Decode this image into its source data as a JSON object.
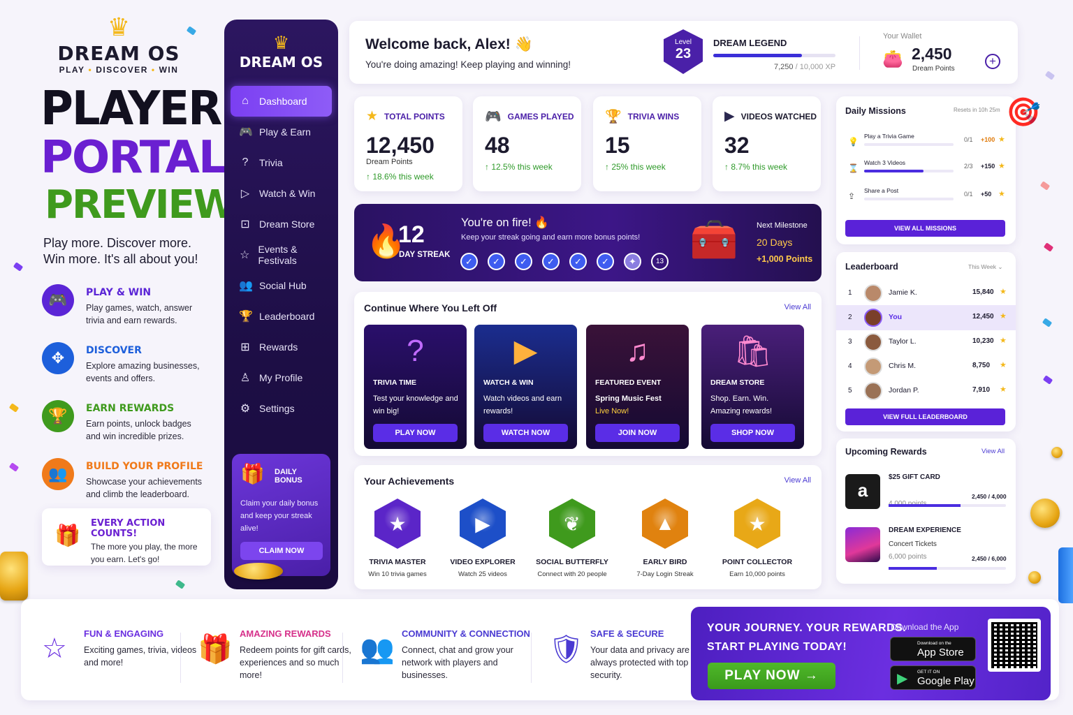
{
  "brand": {
    "name": "DREAM OS",
    "sub": [
      "PLAY",
      "DISCOVER",
      "WIN"
    ],
    "title_line1": "PLAYER",
    "title_line2": "PORTAL",
    "title_line3": "PREVIEW",
    "tagline_1": "Play more. Discover more.",
    "tagline_2": "Win more. It's all about you!"
  },
  "features": [
    {
      "title": "PLAY & WIN",
      "desc": "Play games, watch, answer trivia and earn rewards.",
      "color": "#5b25d6",
      "icon": "gamepad-icon"
    },
    {
      "title": "DISCOVER",
      "desc": "Explore amazing businesses, events and offers.",
      "color": "#1d5fdb",
      "icon": "compass-icon"
    },
    {
      "title": "EARN REWARDS",
      "desc": "Earn points, unlock badges and win incredible prizes.",
      "color": "#3f9a1d",
      "icon": "trophy-icon"
    },
    {
      "title": "BUILD YOUR PROFILE",
      "desc": "Showcase your achievements and climb the leaderboard.",
      "color": "#f07a1a",
      "icon": "people-icon"
    }
  ],
  "every_action": {
    "title": "EVERY ACTION COUNTS!",
    "desc": "The more you play, the more you earn. Let's go!"
  },
  "sidebar": {
    "logo": "DREAM OS",
    "items": [
      {
        "label": "Dashboard",
        "icon": "home-icon",
        "active": true
      },
      {
        "label": "Play & Earn",
        "icon": "gamepad-icon"
      },
      {
        "label": "Trivia",
        "icon": "question-icon"
      },
      {
        "label": "Watch & Win",
        "icon": "play-icon"
      },
      {
        "label": "Dream Store",
        "icon": "bag-icon"
      },
      {
        "label": "Events & Festivals",
        "icon": "star-icon"
      },
      {
        "label": "Social Hub",
        "icon": "people-icon"
      },
      {
        "label": "Leaderboard",
        "icon": "trophy-icon"
      },
      {
        "label": "Rewards",
        "icon": "gift-icon"
      },
      {
        "label": "My Profile",
        "icon": "user-icon"
      },
      {
        "label": "Settings",
        "icon": "gear-icon"
      }
    ],
    "bonus": {
      "title": "DAILY BONUS",
      "desc": "Claim your daily bonus and keep your streak alive!",
      "button": "CLAIM NOW"
    }
  },
  "header": {
    "welcome": "Welcome back, Alex! 👋",
    "subtitle": "You're doing amazing! Keep playing and winning!",
    "level_label": "Level",
    "level": "23",
    "rank": "DREAM LEGEND",
    "xp_text": "7,250",
    "xp_total": " / 10,000 XP",
    "xp_fraction": 0.725,
    "wallet_label": "Your Wallet",
    "wallet_value": "2,450",
    "wallet_unit": "Dream Points"
  },
  "stats": [
    {
      "title": "TOTAL POINTS",
      "value": "12,450",
      "sub": "Dream Points",
      "change": "↑ 18.6% this week",
      "icon": "star-icon",
      "icon_color": "#f4b81b"
    },
    {
      "title": "GAMES PLAYED",
      "value": "48",
      "sub": "",
      "change": "↑ 12.5% this week",
      "icon": "gamepad-icon",
      "icon_color": "#6a2ee0"
    },
    {
      "title": "TRIVIA WINS",
      "value": "15",
      "sub": "",
      "change": "↑ 25% this week",
      "icon": "trophy-icon",
      "icon_color": "#f4b81b"
    },
    {
      "title": "VIDEOS WATCHED",
      "value": "32",
      "sub": "",
      "change": "↑ 8.7% this week",
      "icon": "video-icon",
      "icon_color": "#2b2850"
    }
  ],
  "streak": {
    "days": "12",
    "days_label": "DAY STREAK",
    "title": "You're on fire! 🔥",
    "subtitle": "Keep your streak going and earn more bonus points!",
    "next_day": "13",
    "milestone_label": "Next Milestone",
    "milestone_days": "20 Days",
    "milestone_points": "+1,000 Points"
  },
  "continue": {
    "title": "Continue Where You Left Off",
    "view_all": "View All",
    "cards": [
      {
        "category": "TRIVIA TIME",
        "desc": "Test your knowledge and win big!",
        "desc2": "",
        "button": "PLAY NOW",
        "art": "?",
        "bg": "#2a0f6b"
      },
      {
        "category": "WATCH & WIN",
        "desc": "Watch videos and earn rewards!",
        "desc2": "",
        "button": "WATCH NOW",
        "art": "▶",
        "bg": "#1b2d8f"
      },
      {
        "category": "FEATURED EVENT",
        "desc": "Spring Music Fest",
        "desc2": "Live Now!",
        "button": "JOIN NOW",
        "art": "♫",
        "bg": "#3a1238"
      },
      {
        "category": "DREAM STORE",
        "desc": "Shop. Earn. Win. Amazing rewards!",
        "desc2": "",
        "button": "SHOP NOW",
        "art": "🛍",
        "bg": "#4a1f7a"
      }
    ]
  },
  "achievements": {
    "title": "Your Achievements",
    "view_all": "View All",
    "items": [
      {
        "name": "TRIVIA MASTER",
        "desc": "Win 10 trivia games",
        "glyph": "★",
        "color": "#5b25c8",
        "icon": "trivia-master-badge-icon"
      },
      {
        "name": "VIDEO EXPLORER",
        "desc": "Watch 25 videos",
        "glyph": "▶",
        "color": "#1d4fc8",
        "icon": "video-explorer-badge-icon"
      },
      {
        "name": "SOCIAL BUTTERFLY",
        "desc": "Connect with 20 people",
        "glyph": "❦",
        "color": "#3f9a1d",
        "icon": "social-butterfly-badge-icon"
      },
      {
        "name": "EARLY BIRD",
        "desc": "7-Day Login Streak",
        "glyph": "▲",
        "color": "#e0820f",
        "icon": "early-bird-badge-icon"
      },
      {
        "name": "POINT COLLECTOR",
        "desc": "Earn 10,000 points",
        "glyph": "★",
        "color": "#e8a817",
        "icon": "point-collector-badge-icon"
      }
    ]
  },
  "missions": {
    "title": "Daily Missions",
    "resets": "Resets in 10h 25m",
    "items": [
      {
        "name": "Play a Trivia Game",
        "progress": "0/1",
        "reward": "+100",
        "fraction": 0,
        "icon": "lightbulb-icon"
      },
      {
        "name": "Watch 3 Videos",
        "progress": "2/3",
        "reward": "+150",
        "fraction": 0.667,
        "icon": "hourglass-icon"
      },
      {
        "name": "Share a Post",
        "progress": "0/1",
        "reward": "+50",
        "fraction": 0,
        "icon": "share-icon"
      }
    ],
    "button": "VIEW ALL MISSIONS"
  },
  "leaderboard": {
    "title": "Leaderboard",
    "period": "This Week ⌄",
    "rows": [
      {
        "rank": "1",
        "name": "Jamie K.",
        "points": "15,840"
      },
      {
        "rank": "2",
        "name": "You",
        "points": "12,450"
      },
      {
        "rank": "3",
        "name": "Taylor L.",
        "points": "10,230"
      },
      {
        "rank": "4",
        "name": "Chris M.",
        "points": "8,750"
      },
      {
        "rank": "5",
        "name": "Jordan P.",
        "points": "7,910"
      }
    ],
    "button": "VIEW FULL LEADERBOARD"
  },
  "rewards": {
    "title": "Upcoming Rewards",
    "view_all": "View All",
    "items": [
      {
        "name": "$25 GIFT CARD",
        "sub": "4,000 points",
        "sub2": "",
        "progress": "2,450 / 4,000",
        "fraction": 0.6125
      },
      {
        "name": "DREAM EXPERIENCE",
        "sub": "Concert Tickets",
        "sub2": "6,000 points",
        "progress": "2,450 / 6,000",
        "fraction": 0.408
      }
    ]
  },
  "bottom": {
    "features": [
      {
        "title": "FUN & ENGAGING",
        "desc": "Exciting games, trivia, videos and more!",
        "icon": "star-outline-icon",
        "color": "#6a2ee0"
      },
      {
        "title": "AMAZING REWARDS",
        "desc": "Redeem points for gift cards, experiences and so much more!",
        "icon": "gift-outline-icon",
        "color": "#d6308a"
      },
      {
        "title": "COMMUNITY & CONNECTION",
        "desc": "Connect, chat and grow your network with players and businesses.",
        "icon": "people-outline-icon",
        "color": "#4a3ad2"
      },
      {
        "title": "SAFE & SECURE",
        "desc": "Your data and privacy are always protected with top security.",
        "icon": "shield-outline-icon",
        "color": "#4a3ad2"
      }
    ],
    "cta_line1": "YOUR JOURNEY. YOUR REWARDS.",
    "cta_line2": "START PLAYING TODAY!",
    "cta_button": "PLAY NOW →",
    "download_label": "Download the App",
    "appstore_small": "Download on the",
    "appstore_big": "App Store",
    "googleplay_small": "GET IT ON",
    "googleplay_big": "Google Play"
  }
}
